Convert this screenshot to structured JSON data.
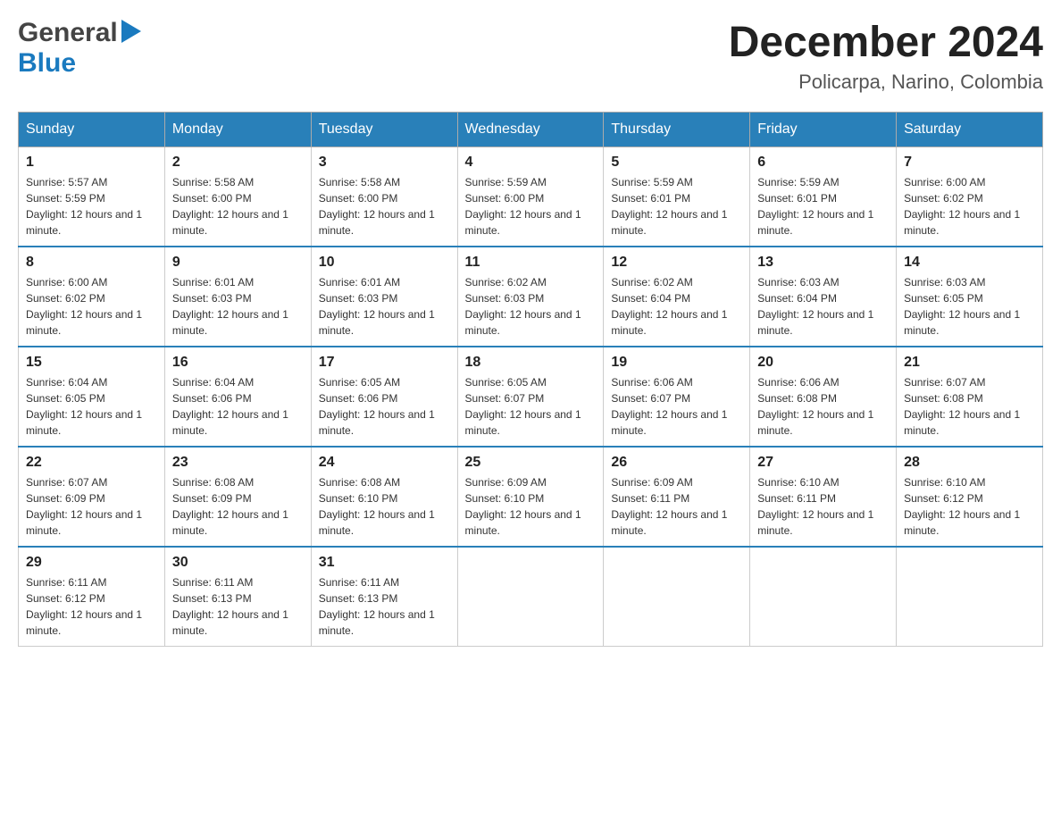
{
  "logo": {
    "general": "General",
    "blue": "Blue",
    "arrow": "▶"
  },
  "title": {
    "month_year": "December 2024",
    "location": "Policarpa, Narino, Colombia"
  },
  "days_of_week": [
    "Sunday",
    "Monday",
    "Tuesday",
    "Wednesday",
    "Thursday",
    "Friday",
    "Saturday"
  ],
  "weeks": [
    [
      {
        "day": "1",
        "sunrise": "5:57 AM",
        "sunset": "5:59 PM",
        "daylight": "12 hours and 1 minute."
      },
      {
        "day": "2",
        "sunrise": "5:58 AM",
        "sunset": "6:00 PM",
        "daylight": "12 hours and 1 minute."
      },
      {
        "day": "3",
        "sunrise": "5:58 AM",
        "sunset": "6:00 PM",
        "daylight": "12 hours and 1 minute."
      },
      {
        "day": "4",
        "sunrise": "5:59 AM",
        "sunset": "6:00 PM",
        "daylight": "12 hours and 1 minute."
      },
      {
        "day": "5",
        "sunrise": "5:59 AM",
        "sunset": "6:01 PM",
        "daylight": "12 hours and 1 minute."
      },
      {
        "day": "6",
        "sunrise": "5:59 AM",
        "sunset": "6:01 PM",
        "daylight": "12 hours and 1 minute."
      },
      {
        "day": "7",
        "sunrise": "6:00 AM",
        "sunset": "6:02 PM",
        "daylight": "12 hours and 1 minute."
      }
    ],
    [
      {
        "day": "8",
        "sunrise": "6:00 AM",
        "sunset": "6:02 PM",
        "daylight": "12 hours and 1 minute."
      },
      {
        "day": "9",
        "sunrise": "6:01 AM",
        "sunset": "6:03 PM",
        "daylight": "12 hours and 1 minute."
      },
      {
        "day": "10",
        "sunrise": "6:01 AM",
        "sunset": "6:03 PM",
        "daylight": "12 hours and 1 minute."
      },
      {
        "day": "11",
        "sunrise": "6:02 AM",
        "sunset": "6:03 PM",
        "daylight": "12 hours and 1 minute."
      },
      {
        "day": "12",
        "sunrise": "6:02 AM",
        "sunset": "6:04 PM",
        "daylight": "12 hours and 1 minute."
      },
      {
        "day": "13",
        "sunrise": "6:03 AM",
        "sunset": "6:04 PM",
        "daylight": "12 hours and 1 minute."
      },
      {
        "day": "14",
        "sunrise": "6:03 AM",
        "sunset": "6:05 PM",
        "daylight": "12 hours and 1 minute."
      }
    ],
    [
      {
        "day": "15",
        "sunrise": "6:04 AM",
        "sunset": "6:05 PM",
        "daylight": "12 hours and 1 minute."
      },
      {
        "day": "16",
        "sunrise": "6:04 AM",
        "sunset": "6:06 PM",
        "daylight": "12 hours and 1 minute."
      },
      {
        "day": "17",
        "sunrise": "6:05 AM",
        "sunset": "6:06 PM",
        "daylight": "12 hours and 1 minute."
      },
      {
        "day": "18",
        "sunrise": "6:05 AM",
        "sunset": "6:07 PM",
        "daylight": "12 hours and 1 minute."
      },
      {
        "day": "19",
        "sunrise": "6:06 AM",
        "sunset": "6:07 PM",
        "daylight": "12 hours and 1 minute."
      },
      {
        "day": "20",
        "sunrise": "6:06 AM",
        "sunset": "6:08 PM",
        "daylight": "12 hours and 1 minute."
      },
      {
        "day": "21",
        "sunrise": "6:07 AM",
        "sunset": "6:08 PM",
        "daylight": "12 hours and 1 minute."
      }
    ],
    [
      {
        "day": "22",
        "sunrise": "6:07 AM",
        "sunset": "6:09 PM",
        "daylight": "12 hours and 1 minute."
      },
      {
        "day": "23",
        "sunrise": "6:08 AM",
        "sunset": "6:09 PM",
        "daylight": "12 hours and 1 minute."
      },
      {
        "day": "24",
        "sunrise": "6:08 AM",
        "sunset": "6:10 PM",
        "daylight": "12 hours and 1 minute."
      },
      {
        "day": "25",
        "sunrise": "6:09 AM",
        "sunset": "6:10 PM",
        "daylight": "12 hours and 1 minute."
      },
      {
        "day": "26",
        "sunrise": "6:09 AM",
        "sunset": "6:11 PM",
        "daylight": "12 hours and 1 minute."
      },
      {
        "day": "27",
        "sunrise": "6:10 AM",
        "sunset": "6:11 PM",
        "daylight": "12 hours and 1 minute."
      },
      {
        "day": "28",
        "sunrise": "6:10 AM",
        "sunset": "6:12 PM",
        "daylight": "12 hours and 1 minute."
      }
    ],
    [
      {
        "day": "29",
        "sunrise": "6:11 AM",
        "sunset": "6:12 PM",
        "daylight": "12 hours and 1 minute."
      },
      {
        "day": "30",
        "sunrise": "6:11 AM",
        "sunset": "6:13 PM",
        "daylight": "12 hours and 1 minute."
      },
      {
        "day": "31",
        "sunrise": "6:11 AM",
        "sunset": "6:13 PM",
        "daylight": "12 hours and 1 minute."
      },
      null,
      null,
      null,
      null
    ]
  ],
  "labels": {
    "sunrise": "Sunrise:",
    "sunset": "Sunset:",
    "daylight": "Daylight:"
  }
}
